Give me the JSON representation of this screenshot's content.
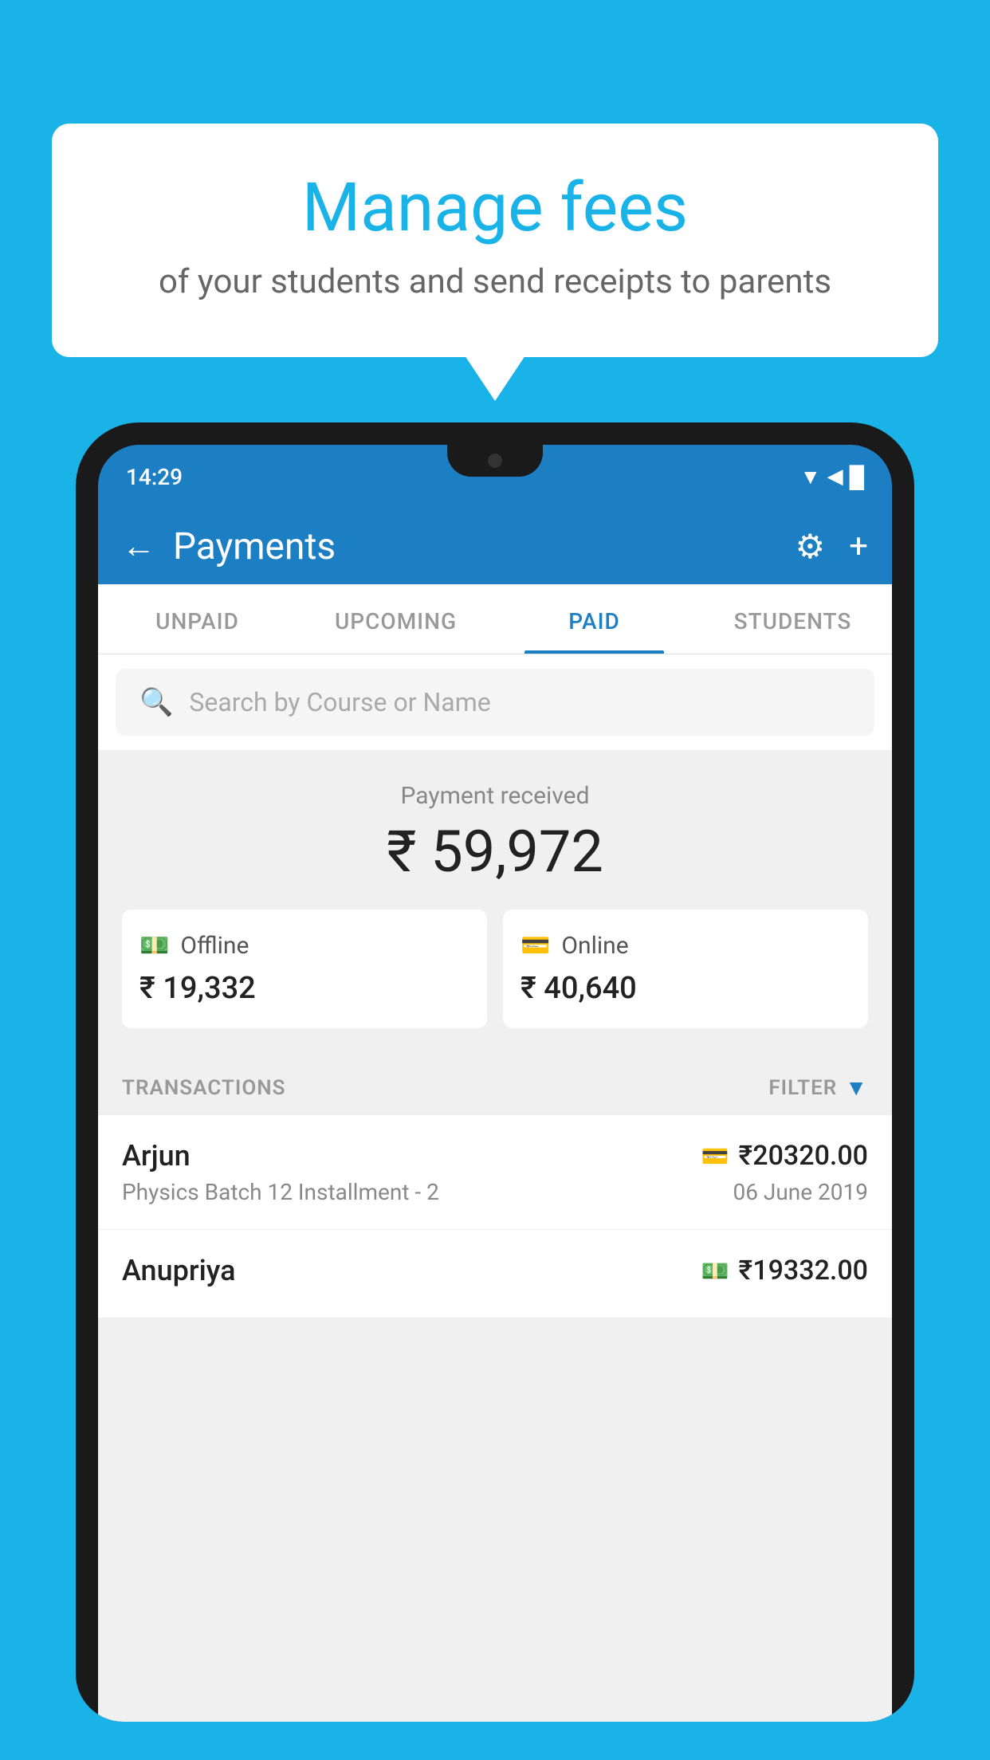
{
  "background_color": "#1ab3e8",
  "speech_bubble": {
    "title": "Manage fees",
    "subtitle": "of your students and send receipts to parents"
  },
  "status_bar": {
    "time": "14:29",
    "icons": "▼◀█"
  },
  "header": {
    "title": "Payments",
    "back_label": "←",
    "gear_label": "⚙",
    "plus_label": "+"
  },
  "tabs": [
    {
      "label": "UNPAID",
      "active": false
    },
    {
      "label": "UPCOMING",
      "active": false
    },
    {
      "label": "PAID",
      "active": true
    },
    {
      "label": "STUDENTS",
      "active": false
    }
  ],
  "search": {
    "placeholder": "Search by Course or Name"
  },
  "payment_summary": {
    "label": "Payment received",
    "total": "₹ 59,972",
    "offline": {
      "label": "Offline",
      "amount": "₹ 19,332"
    },
    "online": {
      "label": "Online",
      "amount": "₹ 40,640"
    }
  },
  "transactions": {
    "header_label": "TRANSACTIONS",
    "filter_label": "FILTER",
    "rows": [
      {
        "name": "Arjun",
        "detail": "Physics Batch 12 Installment - 2",
        "amount": "₹20320.00",
        "date": "06 June 2019",
        "method_icon": "card"
      },
      {
        "name": "Anupriya",
        "detail": "",
        "amount": "₹19332.00",
        "date": "",
        "method_icon": "cash"
      }
    ]
  }
}
